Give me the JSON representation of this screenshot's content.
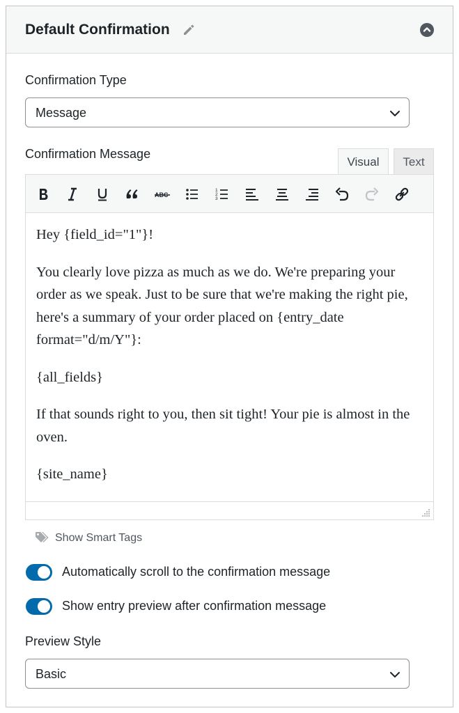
{
  "panel": {
    "title": "Default Confirmation"
  },
  "confirmation_type": {
    "label": "Confirmation Type",
    "value": "Message"
  },
  "confirmation_message": {
    "label": "Confirmation Message",
    "tabs": [
      {
        "label": "Visual",
        "active": true
      },
      {
        "label": "Text",
        "active": false
      }
    ],
    "toolbar": [
      "bold-icon",
      "italic-icon",
      "underline-icon",
      "blockquote-icon",
      "strikethrough-icon",
      "bullet-list-icon",
      "numbered-list-icon",
      "align-left-icon",
      "align-center-icon",
      "align-right-icon",
      "undo-icon",
      "redo-icon",
      "link-icon"
    ],
    "paragraphs": [
      "Hey {field_id=\"1\"}!",
      "You clearly love pizza as much as we do. We're preparing your order as we speak. Just to be sure that we're making the right pie, here's a summary of your order placed on {entry_date format=\"d/m/Y\"}:",
      "{all_fields}",
      "If that sounds right to you, then sit tight! Your pie is almost in the oven.",
      "{site_name}"
    ]
  },
  "smart_tags": {
    "label": "Show Smart Tags"
  },
  "toggles": [
    {
      "label": "Automatically scroll to the confirmation message",
      "on": true
    },
    {
      "label": "Show entry preview after confirmation message",
      "on": true
    }
  ],
  "preview_style": {
    "label": "Preview Style",
    "value": "Basic"
  },
  "colors": {
    "accent": "#036aab",
    "header_bg": "#f6f7f7",
    "border": "#c3c4c7"
  }
}
